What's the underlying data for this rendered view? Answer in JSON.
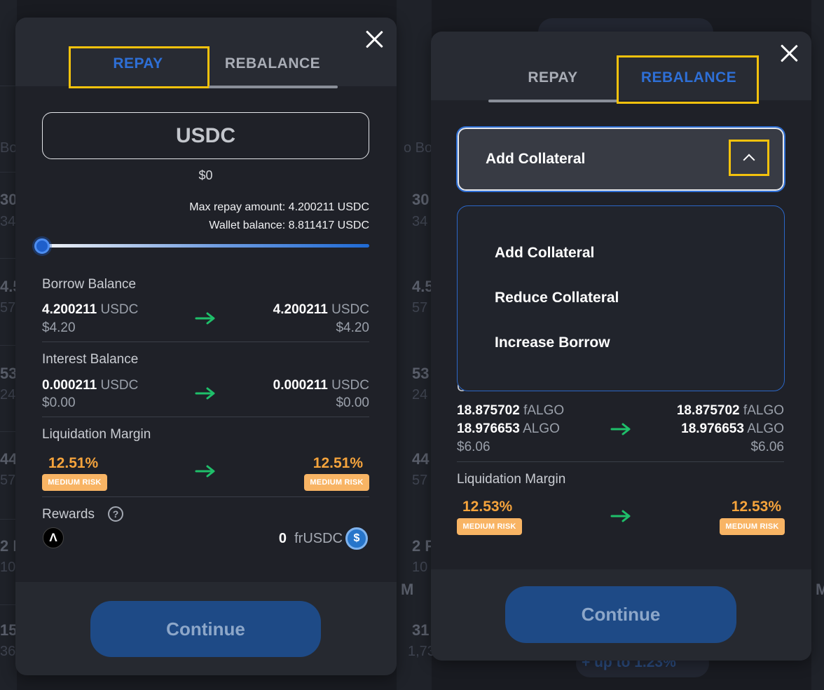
{
  "background": {
    "fragments": [
      "o Bo",
      "30",
      "34",
      "4.5",
      "57",
      "53",
      "24",
      "44",
      "57",
      "2 F",
      "10",
      "15",
      "36",
      "Bo",
      "30",
      "34",
      "4.5",
      "57",
      "53",
      "24",
      "44",
      "57",
      "2 F",
      "10",
      "31",
      "1,73",
      "M",
      "M"
    ],
    "pill_text": "+ up to 1.23%"
  },
  "left_modal": {
    "tabs": {
      "repay": "REPAY",
      "rebalance": "REBALANCE"
    },
    "token": "USDC",
    "amount_usd": "$0",
    "max_repay": "Max repay amount: 4.200211 USDC",
    "wallet_balance": "Wallet balance: 8.811417 USDC",
    "slider_value_pct": 0,
    "borrow_balance": {
      "label": "Borrow Balance",
      "from_amount": "4.200211",
      "from_unit": "USDC",
      "from_usd": "$4.20",
      "to_amount": "4.200211",
      "to_unit": "USDC",
      "to_usd": "$4.20"
    },
    "interest_balance": {
      "label": "Interest Balance",
      "from_amount": "0.000211",
      "from_unit": "USDC",
      "from_usd": "$0.00",
      "to_amount": "0.000211",
      "to_unit": "USDC",
      "to_usd": "$0.00"
    },
    "liquidation_margin": {
      "label": "Liquidation Margin",
      "from_pct": "12.51%",
      "to_pct": "12.51%",
      "risk_label": "MEDIUM RISK"
    },
    "rewards": {
      "label": "Rewards",
      "help": "?",
      "algo_glyph": "Λ",
      "amount": "0",
      "unit": "frUSDC",
      "usdc_glyph": "$"
    },
    "continue_label": "Continue"
  },
  "right_modal": {
    "tabs": {
      "repay": "REPAY",
      "rebalance": "REBALANCE"
    },
    "select_value": "Add Collateral",
    "dropdown_options": [
      "Add Collateral",
      "Reduce Collateral",
      "Increase Borrow"
    ],
    "hidden_label_fragment": "C",
    "collateral": {
      "from_famount": "18.875702",
      "from_funit": "fALGO",
      "from_amount": "18.976653",
      "from_unit": "ALGO",
      "from_usd": "$6.06",
      "to_famount": "18.875702",
      "to_funit": "fALGO",
      "to_amount": "18.976653",
      "to_unit": "ALGO",
      "to_usd": "$6.06"
    },
    "liquidation_margin": {
      "label": "Liquidation Margin",
      "from_pct": "12.53%",
      "to_pct": "12.53%",
      "risk_label": "MEDIUM RISK"
    },
    "continue_label": "Continue"
  },
  "colors": {
    "accent_blue": "#2e6fd6",
    "highlight_yellow": "#f4c20d",
    "risk_orange": "#f6a43c",
    "arrow_green": "#1fbf6a"
  }
}
